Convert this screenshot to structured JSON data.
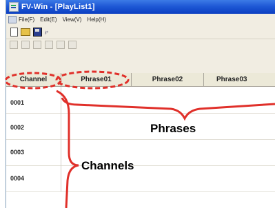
{
  "window": {
    "title": "FV-Win - [PlayList1]"
  },
  "menu": {
    "items": [
      "File(F)",
      "Edit(E)",
      "View(V)",
      "Help(H)"
    ]
  },
  "toolbar": {
    "icons": [
      "new-file-icon",
      "open-folder-icon",
      "save-icon",
      "properties-icon"
    ]
  },
  "grid": {
    "headers": [
      "Channel",
      "Phrase01",
      "Phrase02",
      "Phrase03"
    ],
    "rows": [
      "0001",
      "0002",
      "0003",
      "0004"
    ]
  },
  "annotations": {
    "phrases": "Phrases",
    "channels": "Channels"
  },
  "colors": {
    "annotation_red": "#e0302a",
    "titlebar_blue": "#1f59d6"
  }
}
